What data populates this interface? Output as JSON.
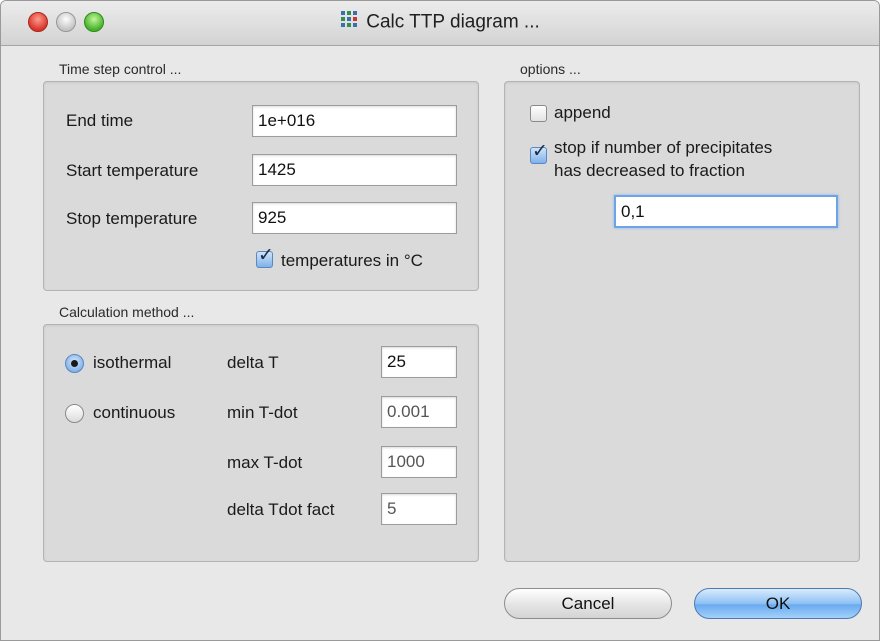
{
  "window": {
    "title": "Calc TTP diagram ..."
  },
  "time_step": {
    "group_label": "Time step control ...",
    "end_time_label": "End time",
    "end_time_value": "1e+016",
    "start_temp_label": "Start temperature",
    "start_temp_value": "1425",
    "stop_temp_label": "Stop temperature",
    "stop_temp_value": "925",
    "celsius_label": "temperatures in °C",
    "celsius_checked": true
  },
  "calc_method": {
    "group_label": "Calculation method ...",
    "isothermal_label": "isothermal",
    "continuous_label": "continuous",
    "selected": "isothermal",
    "delta_t_label": "delta T",
    "delta_t_value": "25",
    "min_tdot_label": "min T-dot",
    "min_tdot_value": "0.001",
    "max_tdot_label": "max T-dot",
    "max_tdot_value": "1000",
    "delta_tdot_fact_label": "delta Tdot fact",
    "delta_tdot_fact_value": "5"
  },
  "options": {
    "group_label": "options ...",
    "append_label": "append",
    "append_checked": false,
    "stop_label_line1": "stop if number of precipitates",
    "stop_label_line2": "has decreased to fraction",
    "stop_checked": true,
    "fraction_value": "0,1"
  },
  "buttons": {
    "cancel": "Cancel",
    "ok": "OK"
  }
}
